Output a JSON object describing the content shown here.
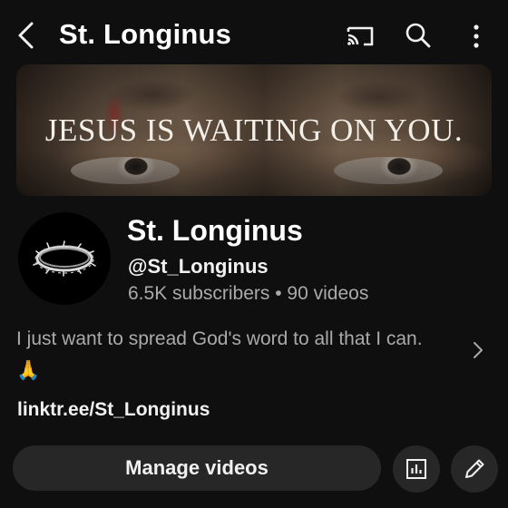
{
  "header": {
    "title": "St. Longinus",
    "icons": [
      "back-arrow-icon",
      "cast-icon",
      "search-icon",
      "more-vert-icon"
    ]
  },
  "banner": {
    "text": "JESUS IS WAITING ON YOU."
  },
  "channel": {
    "name": "St. Longinus",
    "handle": "@St_Longinus",
    "stats": "6.5K subscribers • 90 videos",
    "description": "I just want to spread God's word to all that I can. 🙏",
    "link": "linktr.ee/St_Longinus",
    "avatar_icon": "crown-of-thorns-icon"
  },
  "actions": {
    "manage_label": "Manage videos",
    "icons": [
      "analytics-icon",
      "edit-pencil-icon"
    ]
  },
  "colors": {
    "background": "#0f0f0f",
    "button_bg": "#272727",
    "primary_text": "#f1f1f1",
    "secondary_text": "#aaaaaa"
  }
}
